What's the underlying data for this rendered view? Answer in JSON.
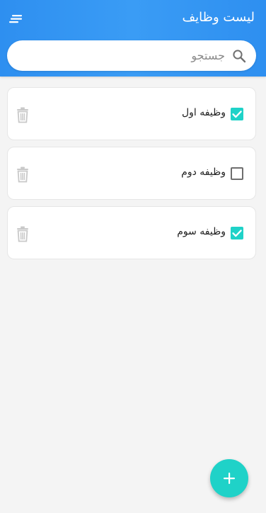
{
  "header": {
    "title": "لیست وظایف",
    "menu_icon": "sort-menu-icon"
  },
  "search": {
    "placeholder": "جستجو",
    "value": "",
    "icon": "search-icon"
  },
  "tasks": [
    {
      "text": "وظیفه اول",
      "checked": true
    },
    {
      "text": "وظیفه دوم",
      "checked": false
    },
    {
      "text": "وظیفه سوم",
      "checked": true
    }
  ],
  "fab": {
    "icon": "plus-icon"
  },
  "colors": {
    "header": "#2e8ff0",
    "accent": "#1fd2c8",
    "background": "#f4f4f4"
  }
}
